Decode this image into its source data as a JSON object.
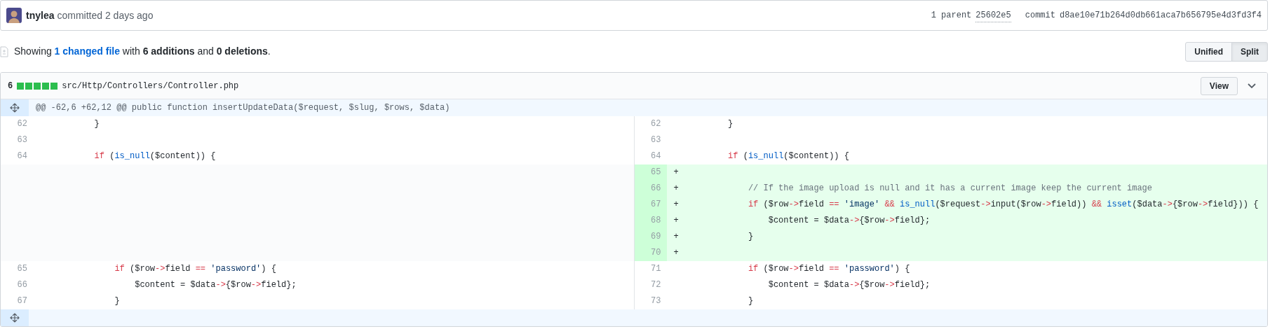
{
  "commit": {
    "author": "tnylea",
    "action": "committed 2 days ago",
    "parent_count": "1 parent",
    "parent_sha": "25602e5",
    "commit_label": "commit",
    "commit_sha": "d8ae10e71b264d0db661aca7b656795e4d3fd3f4"
  },
  "summary": {
    "prefix": "Showing ",
    "link": "1 changed file",
    "rest": " with **6 additions** and **0 deletions**."
  },
  "view_modes": [
    {
      "label": "Unified",
      "selected": false
    },
    {
      "label": "Split",
      "selected": true
    }
  ],
  "file": {
    "count": "6",
    "path": "src/Http/Controllers/Controller.php",
    "view_button": "View",
    "hunk_header": "@@ -62,6 +62,12 @@ public function insertUpdateData($request, $slug, $rows, $data)"
  },
  "rows": [
    {
      "left": {
        "kind": "context",
        "number": "62",
        "tokens": [
          {
            "kind": "plain",
            "text": "        }"
          }
        ]
      },
      "right": {
        "kind": "context",
        "number": "62",
        "tokens": [
          {
            "kind": "plain",
            "text": "        }"
          }
        ]
      }
    },
    {
      "left": {
        "kind": "context",
        "number": "63"
      },
      "right": {
        "kind": "context",
        "number": "63"
      }
    },
    {
      "left": {
        "kind": "context",
        "number": "64",
        "tokens": [
          {
            "kind": "keyword",
            "text": "        if"
          },
          {
            "kind": "plain",
            "text": " ("
          },
          {
            "kind": "function",
            "text": "is_null"
          },
          {
            "kind": "plain",
            "text": "($content)) {"
          }
        ]
      },
      "right": {
        "kind": "context",
        "number": "64",
        "tokens": [
          {
            "kind": "keyword",
            "text": "        if"
          },
          {
            "kind": "plain",
            "text": " ("
          },
          {
            "kind": "function",
            "text": "is_null"
          },
          {
            "kind": "plain",
            "text": "($content)) {"
          }
        ]
      }
    },
    {
      "left": {
        "kind": "empty"
      },
      "right": {
        "kind": "addition",
        "number": "65",
        "marker": "+"
      }
    },
    {
      "left": {
        "kind": "empty"
      },
      "right": {
        "kind": "addition",
        "number": "66",
        "marker": "+",
        "tokens": [
          {
            "kind": "comment",
            "text": "            // If the image upload is null and it has a current image keep the current image"
          }
        ]
      }
    },
    {
      "left": {
        "kind": "empty"
      },
      "right": {
        "kind": "addition",
        "number": "67",
        "marker": "+",
        "tokens": [
          {
            "kind": "keyword",
            "text": "            if"
          },
          {
            "kind": "plain",
            "text": " ($row"
          },
          {
            "kind": "operator",
            "text": "->"
          },
          {
            "kind": "plain",
            "text": "field "
          },
          {
            "kind": "operator",
            "text": "=="
          },
          {
            "kind": "string",
            "text": " 'image' "
          },
          {
            "kind": "operator",
            "text": "&&"
          },
          {
            "kind": "function",
            "text": " is_null"
          },
          {
            "kind": "plain",
            "text": "($request"
          },
          {
            "kind": "operator",
            "text": "->"
          },
          {
            "kind": "plain",
            "text": "input($row"
          },
          {
            "kind": "operator",
            "text": "->"
          },
          {
            "kind": "plain",
            "text": "field)) "
          },
          {
            "kind": "operator",
            "text": "&&"
          },
          {
            "kind": "function",
            "text": " isset"
          },
          {
            "kind": "plain",
            "text": "($data"
          },
          {
            "kind": "operator",
            "text": "->"
          },
          {
            "kind": "plain",
            "text": "{$row"
          },
          {
            "kind": "operator",
            "text": "->"
          },
          {
            "kind": "plain",
            "text": "field})) {"
          }
        ]
      }
    },
    {
      "left": {
        "kind": "empty"
      },
      "right": {
        "kind": "addition",
        "number": "68",
        "marker": "+",
        "tokens": [
          {
            "kind": "plain",
            "text": "                $content = $data"
          },
          {
            "kind": "operator",
            "text": "->"
          },
          {
            "kind": "plain",
            "text": "{$row"
          },
          {
            "kind": "operator",
            "text": "->"
          },
          {
            "kind": "plain",
            "text": "field};"
          }
        ]
      }
    },
    {
      "left": {
        "kind": "empty"
      },
      "right": {
        "kind": "addition",
        "number": "69",
        "marker": "+",
        "tokens": [
          {
            "kind": "plain",
            "text": "            }"
          }
        ]
      }
    },
    {
      "left": {
        "kind": "empty"
      },
      "right": {
        "kind": "addition",
        "number": "70",
        "marker": "+"
      }
    },
    {
      "left": {
        "kind": "context",
        "number": "65",
        "tokens": [
          {
            "kind": "keyword",
            "text": "            if"
          },
          {
            "kind": "plain",
            "text": " ($row"
          },
          {
            "kind": "operator",
            "text": "->"
          },
          {
            "kind": "plain",
            "text": "field "
          },
          {
            "kind": "operator",
            "text": "=="
          },
          {
            "kind": "string",
            "text": " 'password'"
          },
          {
            "kind": "plain",
            "text": ") {"
          }
        ]
      },
      "right": {
        "kind": "context",
        "number": "71",
        "tokens": [
          {
            "kind": "keyword",
            "text": "            if"
          },
          {
            "kind": "plain",
            "text": " ($row"
          },
          {
            "kind": "operator",
            "text": "->"
          },
          {
            "kind": "plain",
            "text": "field "
          },
          {
            "kind": "operator",
            "text": "=="
          },
          {
            "kind": "string",
            "text": " 'password'"
          },
          {
            "kind": "plain",
            "text": ") {"
          }
        ]
      }
    },
    {
      "left": {
        "kind": "context",
        "number": "66",
        "tokens": [
          {
            "kind": "plain",
            "text": "                $content = $data"
          },
          {
            "kind": "operator",
            "text": "->"
          },
          {
            "kind": "plain",
            "text": "{$row"
          },
          {
            "kind": "operator",
            "text": "->"
          },
          {
            "kind": "plain",
            "text": "field};"
          }
        ]
      },
      "right": {
        "kind": "context",
        "number": "72",
        "tokens": [
          {
            "kind": "plain",
            "text": "                $content = $data"
          },
          {
            "kind": "operator",
            "text": "->"
          },
          {
            "kind": "plain",
            "text": "{$row"
          },
          {
            "kind": "operator",
            "text": "->"
          },
          {
            "kind": "plain",
            "text": "field};"
          }
        ]
      }
    },
    {
      "left": {
        "kind": "context",
        "number": "67",
        "tokens": [
          {
            "kind": "plain",
            "text": "            }"
          }
        ]
      },
      "right": {
        "kind": "context",
        "number": "73",
        "tokens": [
          {
            "kind": "plain",
            "text": "            }"
          }
        ]
      }
    }
  ]
}
